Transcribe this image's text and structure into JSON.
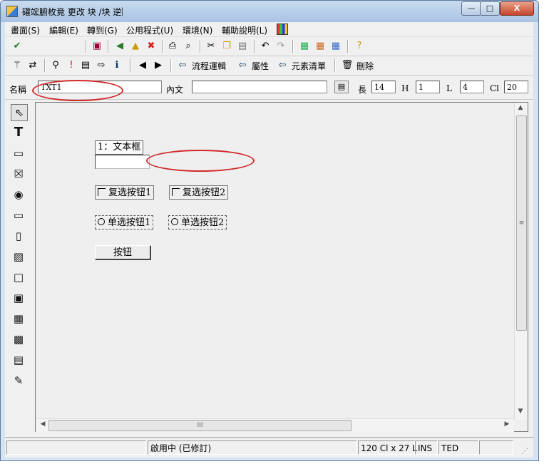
{
  "window": {
    "title": "礶竤腑枚竟   更改 块   /块   逆︴",
    "controls": {
      "minimize": "—",
      "maximize": "□",
      "close": "X"
    }
  },
  "menu": {
    "items": [
      "畫面(S)",
      "編輯(E)",
      "轉到(G)",
      "公用程式(U)",
      "環境(N)",
      "輔助說明(L)"
    ]
  },
  "toolbar2": {
    "flow_logic": "流程運輯",
    "attributes": "屬性",
    "element_list": "元素清單",
    "delete": "刪除"
  },
  "properties": {
    "name_label": "名稱",
    "name_value": "TXT1",
    "text_label": "內文",
    "text_value": "",
    "length_label": "長",
    "length_value": "14",
    "h_label": "H",
    "h_value": "1",
    "l_label": "L",
    "l_value": "4",
    "cl_label": "Cl",
    "cl_value": "20"
  },
  "form": {
    "label_text": "1：文本框",
    "checkbox1": "复选按钮1",
    "checkbox2": "复选按钮2",
    "radio1": "单选按钮1",
    "radio2": "单选按钮2",
    "button": "按钮"
  },
  "scroll": {
    "h_thumb_glyph": "III",
    "v_thumb_glyph": "≡"
  },
  "status": {
    "mode": "啟用中 (已修訂)",
    "size": "120 Cl x 27 L",
    "ins": "INS",
    "ted": "TED"
  },
  "colors": {
    "annotation": "#d12a2a",
    "titlebar": "#b8cde8"
  }
}
